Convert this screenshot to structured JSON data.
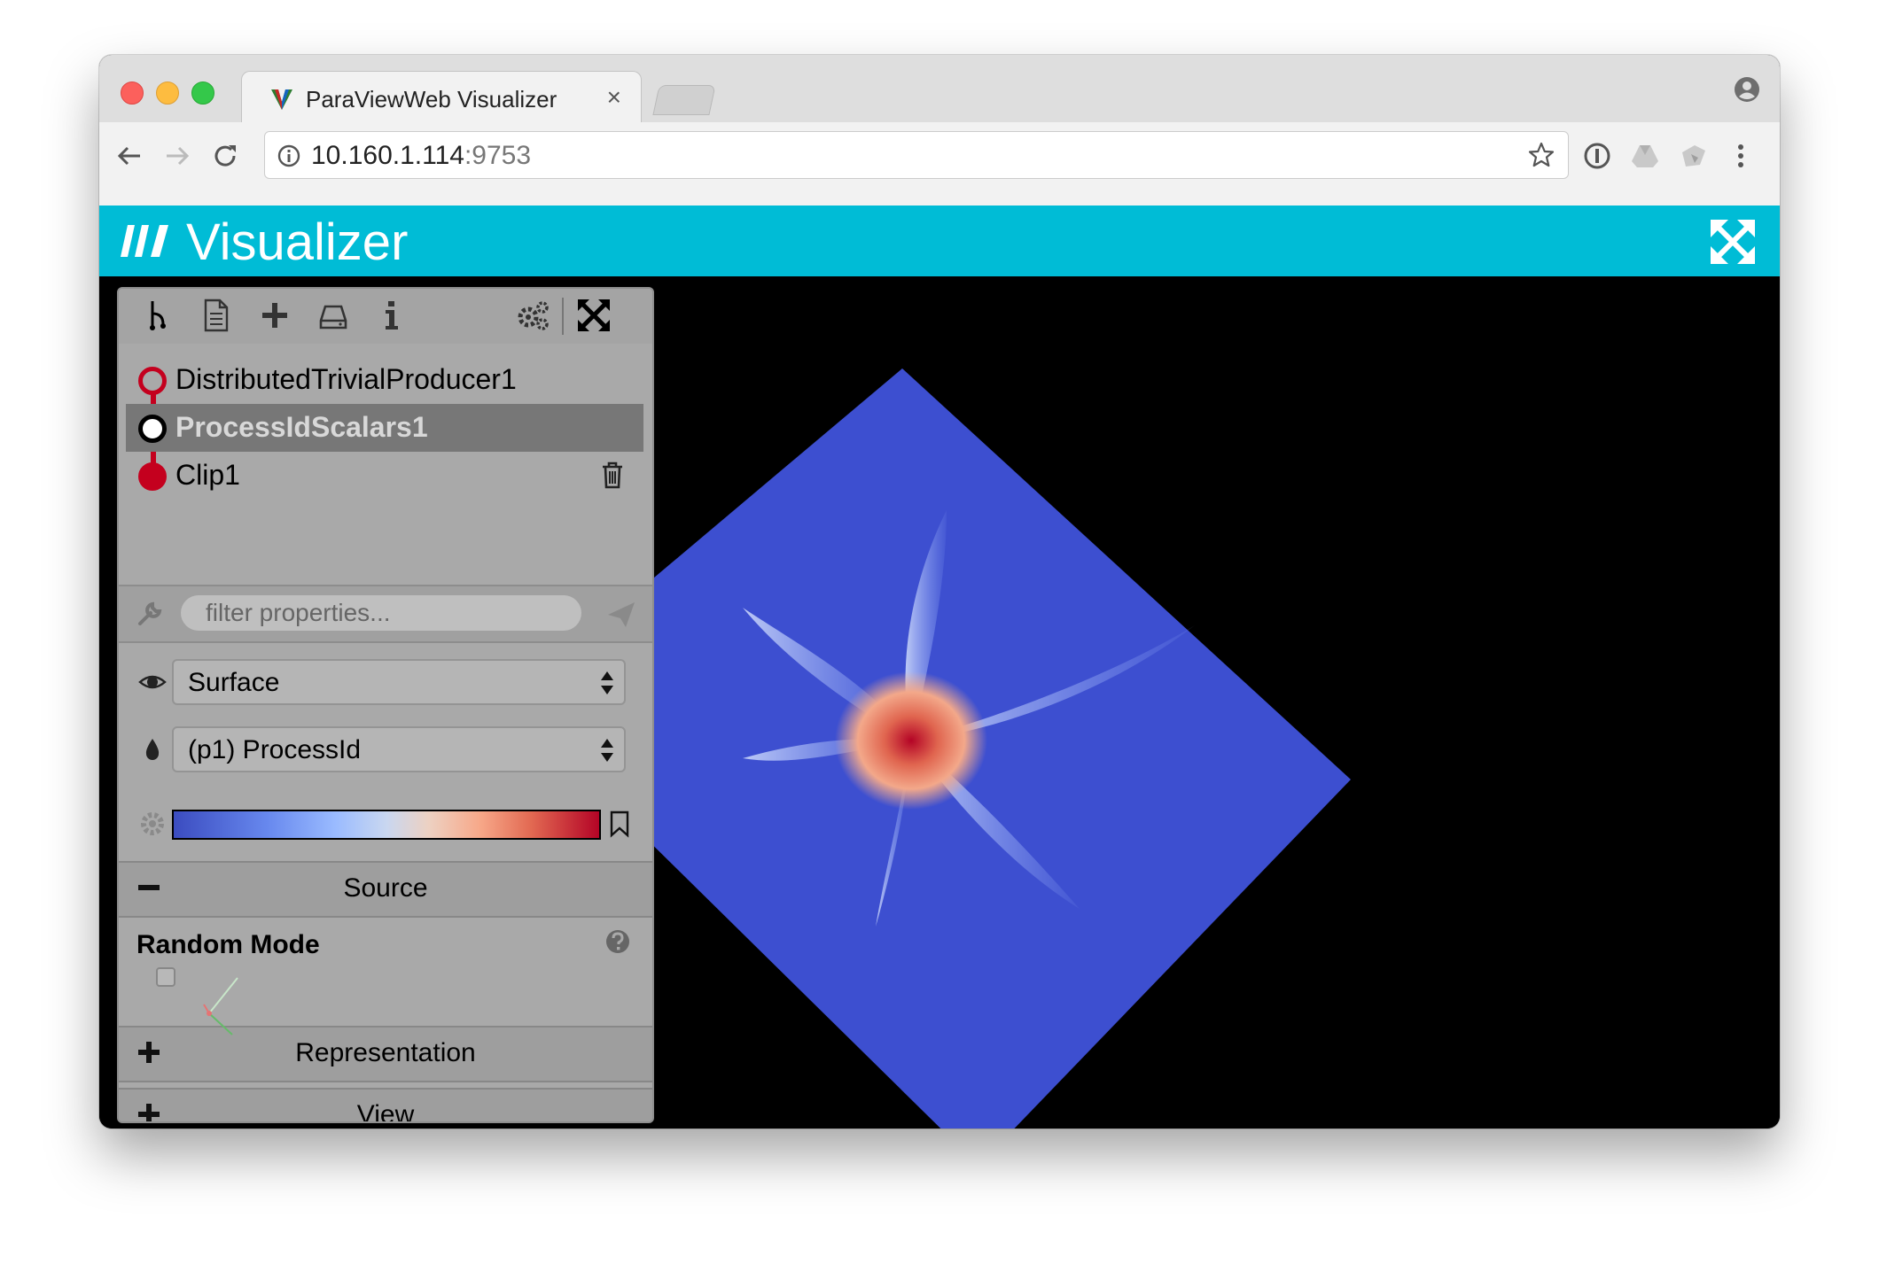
{
  "browser": {
    "tab_title": "ParaViewWeb Visualizer",
    "tab_close": "×",
    "url_host": "10.160.1.114",
    "url_port": ":9753"
  },
  "app": {
    "title": "Visualizer"
  },
  "pipeline": {
    "items": [
      {
        "label": "DistributedTrivialProducer1"
      },
      {
        "label": "ProcessIdScalars1"
      },
      {
        "label": "Clip1"
      }
    ]
  },
  "filter": {
    "placeholder": "filter properties..."
  },
  "representation": {
    "value": "Surface"
  },
  "color_by": {
    "value": "(p1) ProcessId"
  },
  "sections": {
    "source": "Source",
    "representation": "Representation",
    "view": "View"
  },
  "source_props": {
    "random_mode_label": "Random Mode",
    "random_mode_checked": false
  },
  "colors": {
    "header": "#00bcd6",
    "pipeline_red": "#c4001e",
    "render_blue": "#3d4fd0"
  }
}
